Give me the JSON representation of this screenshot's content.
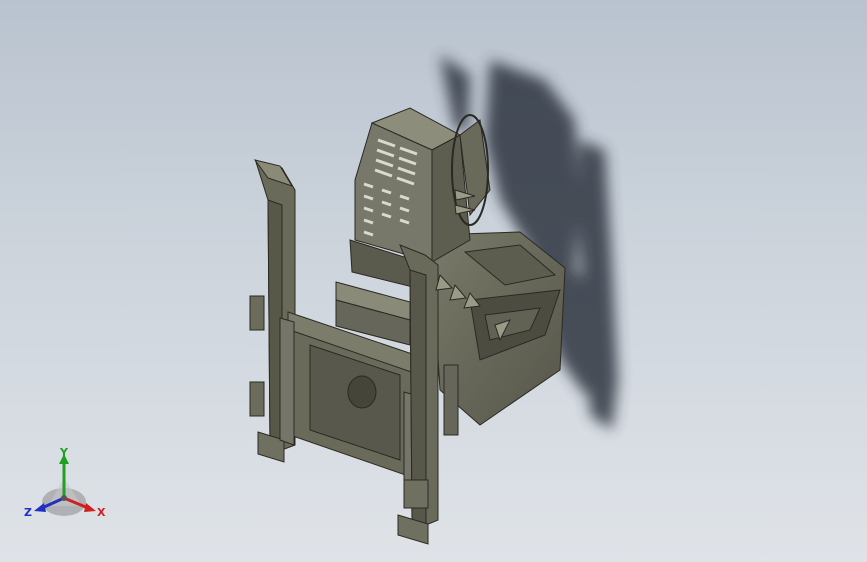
{
  "viewport": {
    "background_top": "#b9c3cf",
    "background_bottom": "#dfe3e8",
    "model_color": "#6b6b5c",
    "model_dark": "#3a3a32",
    "model_light": "#8e8e7c",
    "shadow_color": "#2e3540"
  },
  "triad": {
    "x_label": "X",
    "y_label": "Y",
    "z_label": "Z",
    "x_color": "#d02020",
    "y_color": "#20a020",
    "z_color": "#2030c0"
  }
}
